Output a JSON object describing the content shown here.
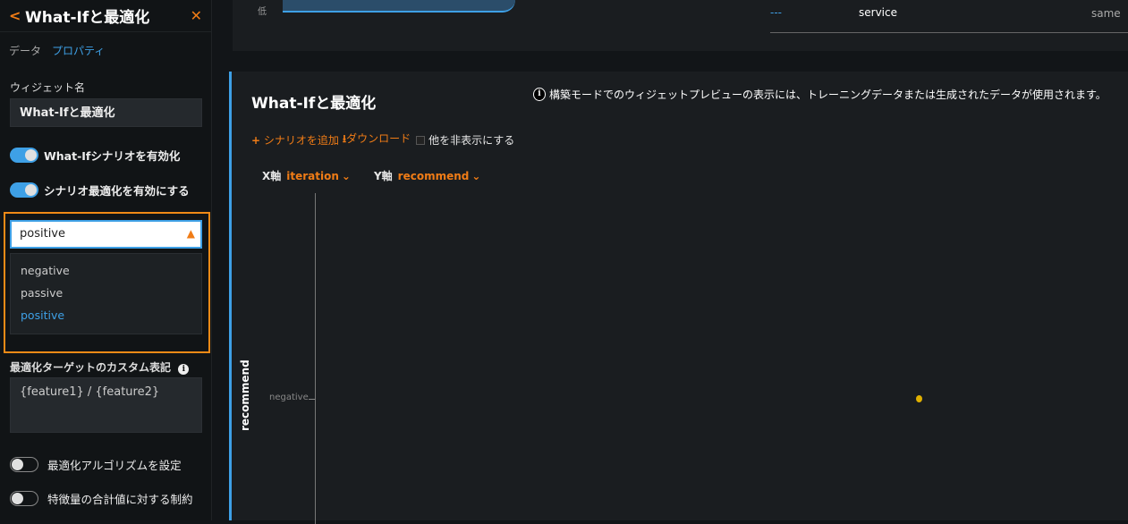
{
  "sidebar": {
    "title": "What-Ifと最適化",
    "tabs": [
      "データ",
      "プロパティ"
    ],
    "widget_name_label": "ウィジェット名",
    "widget_name_value": "What-Ifと最適化",
    "toggles": [
      {
        "label": "What-Ifシナリオを有効化",
        "on": true
      },
      {
        "label": "シナリオ最適化を有効にする",
        "on": true
      },
      {
        "label": "最適化アルゴリズムを設定",
        "on": false
      },
      {
        "label": "特徴量の合計値に対する制約",
        "on": false
      }
    ],
    "select_value": "positive",
    "options": [
      "negative",
      "passive",
      "positive"
    ],
    "custom_label": "最適化ターゲットのカスタム表記",
    "custom_value": "{feature1} / {feature2}"
  },
  "top_card": {
    "low_label": "低",
    "legend_item": "service",
    "legend_value": "same"
  },
  "widget": {
    "title": "What-Ifと最適化",
    "notice": "構築モードでのウィジェットプレビューの表示には、トレーニングデータまたは生成されたデータが使用されます。",
    "add_scenario": "シナリオを追加",
    "download": "ダウンロード",
    "hide_others": "他を非表示にする",
    "x_axis_label": "X軸",
    "x_axis_value": "iteration",
    "y_axis_label": "Y軸",
    "y_axis_value": "recommend",
    "y_title": "recommend",
    "y_tick": "negative"
  },
  "colors": {
    "accent": "#f07c16",
    "blue": "#3ea0e6",
    "point": "#e0b000"
  }
}
